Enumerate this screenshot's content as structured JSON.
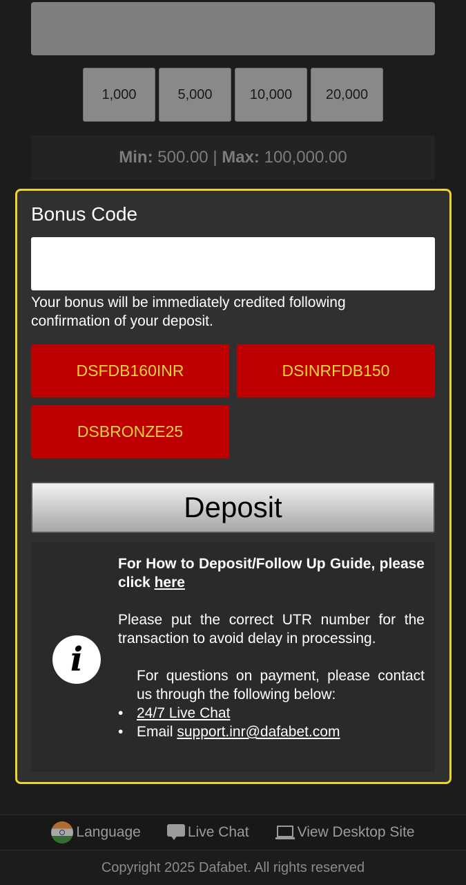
{
  "amount": {
    "value": ""
  },
  "quick_amounts": [
    "1,000",
    "5,000",
    "10,000",
    "20,000"
  ],
  "limits": {
    "min_label": "Min:",
    "min_value": "500.00",
    "separator": "|",
    "max_label": "Max:",
    "max_value": "100,000.00"
  },
  "bonus": {
    "title": "Bonus Code",
    "input_value": "",
    "note": "Your bonus will be immediately credited following confirmation of your deposit.",
    "codes": [
      "DSFDB160INR",
      "DSINRFDB150",
      "DSBRONZE25"
    ]
  },
  "deposit_label": "Deposit",
  "info": {
    "icon": "info-icon",
    "guide_text": "For How to Deposit/Follow Up Guide, please click",
    "guide_link": "here",
    "utr_text": "Please put the correct UTR number for the transaction to avoid delay in processing.",
    "contact_text": "For questions on payment, please contact us through the following below:",
    "live_chat": "24/7 Live Chat",
    "email_label": "Email",
    "email": "support.inr@dafabet.com"
  },
  "footer": {
    "language": "Language",
    "live_chat": "Live Chat",
    "desktop": "View Desktop Site",
    "copyright": "Copyright 2025 Dafabet. All rights reserved"
  },
  "colors": {
    "accent_border": "#f0d429",
    "code_button_bg": "#bf0000",
    "code_button_text": "#f5d33a"
  }
}
